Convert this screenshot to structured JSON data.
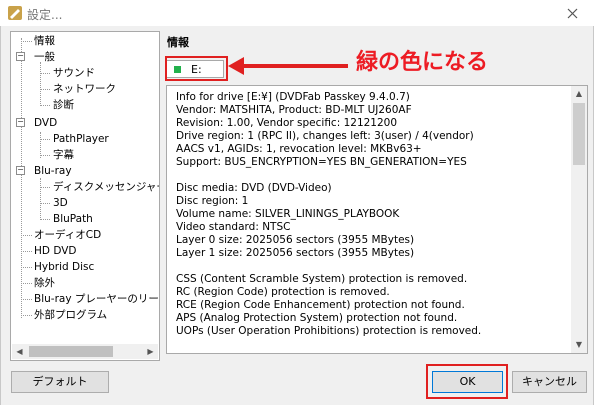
{
  "window": {
    "title": "設定..."
  },
  "tree": {
    "items": [
      {
        "label": "情報"
      },
      {
        "label": "一般"
      },
      {
        "label": "サウンド"
      },
      {
        "label": "ネットワーク"
      },
      {
        "label": "診断"
      },
      {
        "label": "DVD"
      },
      {
        "label": "PathPlayer"
      },
      {
        "label": "字幕"
      },
      {
        "label": "Blu-ray"
      },
      {
        "label": "ディスクメッセンジャー"
      },
      {
        "label": "3D"
      },
      {
        "label": "BluPath"
      },
      {
        "label": "オーディオCD"
      },
      {
        "label": "HD DVD"
      },
      {
        "label": "Hybrid Disc"
      },
      {
        "label": "除外"
      },
      {
        "label": "Blu-ray プレーヤーのリージ"
      },
      {
        "label": "外部プログラム"
      }
    ]
  },
  "section": {
    "title": "情報"
  },
  "drive": {
    "label": "E:",
    "led_color": "#22b14c"
  },
  "annotation": {
    "text": "緑の色になる",
    "color": "#ed1c24"
  },
  "info": {
    "lines": [
      "Info for drive [E:¥] (DVDFab Passkey 9.4.0.7)",
      "Vendor: MATSHITA, Product: BD-MLT UJ260AF",
      "Revision: 1.00, Vendor specific: 12121200",
      "Drive region: 1 (RPC II), changes left: 3(user) / 4(vendor)",
      "AACS v1, AGIDs: 1, revocation level: MKBv63+",
      "Support: BUS_ENCRYPTION=YES BN_GENERATION=YES",
      "",
      "Disc media: DVD (DVD-Video)",
      "Disc region: 1",
      "Volume name: SILVER_LININGS_PLAYBOOK",
      "Video standard: NTSC",
      "Layer 0 size: 2025056 sectors (3955 MBytes)",
      "Layer 1 size: 2025056 sectors (3955 MBytes)",
      "",
      "CSS (Content Scramble System) protection is removed.",
      "RC (Region Code) protection is removed.",
      "RCE (Region Code Enhancement) protection not found.",
      "APS (Analog Protection System) protection not found.",
      "UOPs (User Operation Prohibitions) protection is removed.",
      ""
    ]
  },
  "buttons": {
    "default": "デフォルト",
    "ok": "OK",
    "cancel": "キャンセル"
  }
}
